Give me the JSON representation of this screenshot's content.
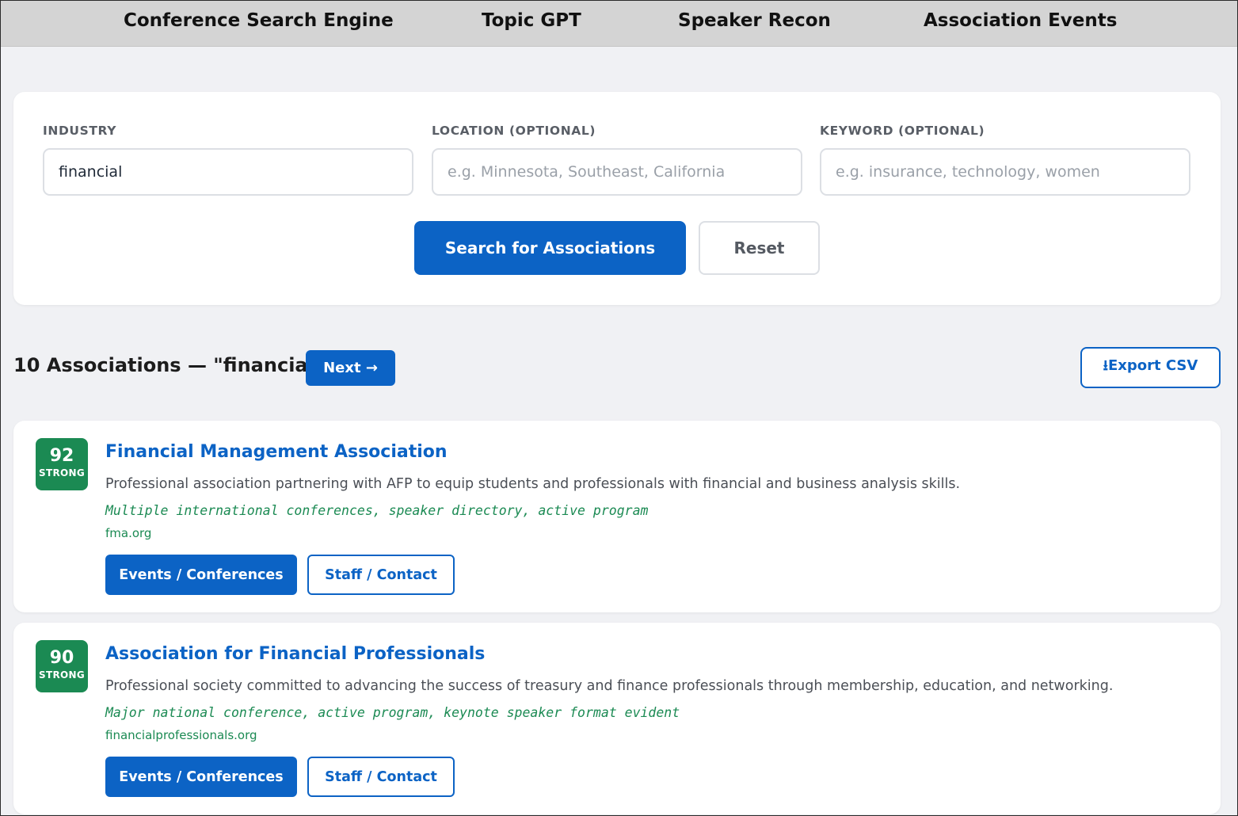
{
  "nav": {
    "items": [
      {
        "label": "Conference Search Engine"
      },
      {
        "label": "Topic GPT"
      },
      {
        "label": "Speaker Recon"
      },
      {
        "label": "Association Events"
      }
    ]
  },
  "search": {
    "industry_label": "INDUSTRY",
    "industry_value": "financial",
    "location_label": "LOCATION (OPTIONAL)",
    "location_placeholder": "e.g. Minnesota, Southeast, California",
    "keyword_label": "KEYWORD (OPTIONAL)",
    "keyword_placeholder": "e.g. insurance, technology, women",
    "search_button": "Search for Associations",
    "reset_button": "Reset"
  },
  "results": {
    "title": "10 Associations — \"financial\"",
    "next_button": "Next →",
    "export_button": "⭳Export CSV",
    "items": [
      {
        "score": "92",
        "score_label": "STRONG",
        "name": "Financial Management Association",
        "description": "Professional association partnering with AFP to equip students and professionals with financial and business analysis skills.",
        "note": "Multiple international conferences, speaker directory, active program",
        "url": "fma.org",
        "events_button": "Events / Conferences",
        "staff_button": "Staff / Contact"
      },
      {
        "score": "90",
        "score_label": "STRONG",
        "name": "Association for Financial Professionals",
        "description": "Professional society committed to advancing the success of treasury and finance professionals through membership, education, and networking.",
        "note": "Major national conference, active program, keynote speaker format evident",
        "url": "financialprofessionals.org",
        "events_button": "Events / Conferences",
        "staff_button": "Staff / Contact"
      }
    ]
  },
  "colors": {
    "primary": "#0c63c5",
    "score_green": "#1b8a53",
    "background": "#f0f1f4",
    "nav_background": "#d4d4d4"
  }
}
